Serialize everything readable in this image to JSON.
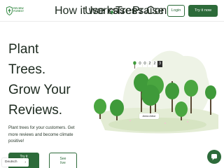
{
  "brand": {
    "line1": "REVIEW",
    "line2": "FOREST",
    "color": "#3f8f4d"
  },
  "nav": {
    "how_it_works": "How it works",
    "use_cases": "Use cases",
    "trees": "Trees",
    "praise": "Praise",
    "contact": "Contact us"
  },
  "header": {
    "login": "Login",
    "try_it_now": "Try it now"
  },
  "hero": {
    "title_lines": [
      "Plant",
      "Trees.",
      "Grow Your",
      "Reviews."
    ],
    "subtitle": "Plant trees for your customers. Get more reviews and become climate positive!",
    "cta_primary": "Try it\nnow",
    "cta_secondary": "See\nlive"
  },
  "counter": {
    "digits": [
      "0",
      "0",
      "2",
      "2",
      "3"
    ]
  },
  "tree_label": "Anna Arbor",
  "language": {
    "selected": "Deutsch"
  },
  "colors": {
    "primary": "#2d6b3a",
    "tree_green": "#3f9a3a",
    "bg_blob": "#eef3e6"
  }
}
